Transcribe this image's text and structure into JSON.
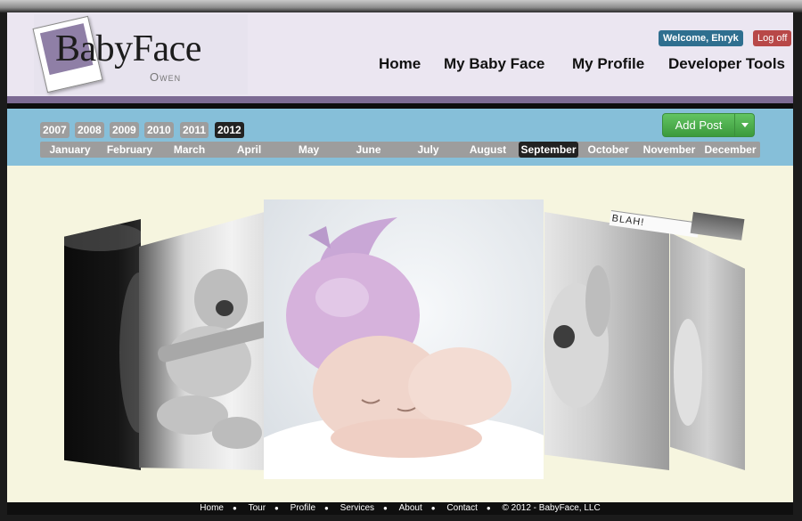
{
  "brand": {
    "name": "BabyFace",
    "child": "Owen"
  },
  "user": {
    "welcome": "Welcome, Ehryk",
    "logoff": "Log off"
  },
  "nav": [
    "Home",
    "My Baby Face",
    "My Profile",
    "Developer Tools"
  ],
  "years": [
    "2007",
    "2008",
    "2009",
    "2010",
    "2011",
    "2012"
  ],
  "active_year": "2012",
  "months": [
    "January",
    "February",
    "March",
    "April",
    "May",
    "June",
    "July",
    "August",
    "September",
    "October",
    "November",
    "December"
  ],
  "active_month": "September",
  "add_post": "Add Post",
  "photo_caption": "BLAH!",
  "footer": {
    "links": [
      "Home",
      "Tour",
      "Profile",
      "Services",
      "About",
      "Contact"
    ],
    "copyright": "© 2012 - BabyFace, LLC"
  },
  "colors": {
    "header_bg": "#ebe6f1",
    "toolbar_bg": "#86bfd9",
    "main_bg": "#f6f5df",
    "accent_purple": "#7c6a93",
    "add_post_green": "#4cae4c"
  }
}
